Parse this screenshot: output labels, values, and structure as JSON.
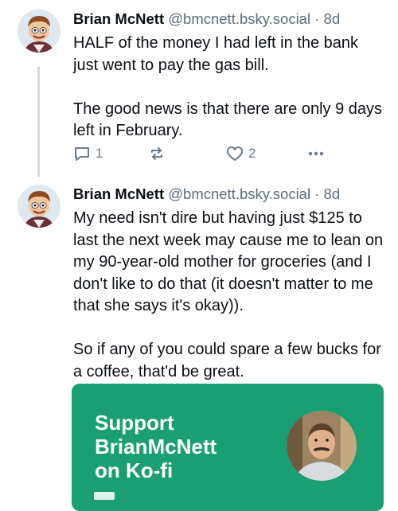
{
  "posts": [
    {
      "author_name": "Brian McNett",
      "handle": "@bmcnett.bsky.social",
      "separator": "·",
      "age": "8d",
      "paragraphs": [
        "HALF of the money I had left in the bank just went to pay the gas bill.",
        "The good news is that there are only 9 days left in February."
      ],
      "reply_count": "1",
      "like_count": "2"
    },
    {
      "author_name": "Brian McNett",
      "handle": "@bmcnett.bsky.social",
      "separator": "·",
      "age": "8d",
      "paragraphs": [
        "My need isn't dire but having just $125 to last the next week may cause me to lean on my 90-year-old mother for groceries (and I don't like to do that (it doesn't matter to me that she says it's okay)).",
        "So if any of you could spare a few bucks for a coffee, that'd be great."
      ]
    }
  ],
  "link_card": {
    "title_line1": "Support",
    "title_line2": "BrianMcNett",
    "title_line3": "on Ko-fi",
    "background_color": "#1a9e74"
  },
  "icons": {
    "reply": "reply-icon",
    "repost": "repost-icon",
    "like": "heart-icon",
    "more": "more-options-icon"
  }
}
